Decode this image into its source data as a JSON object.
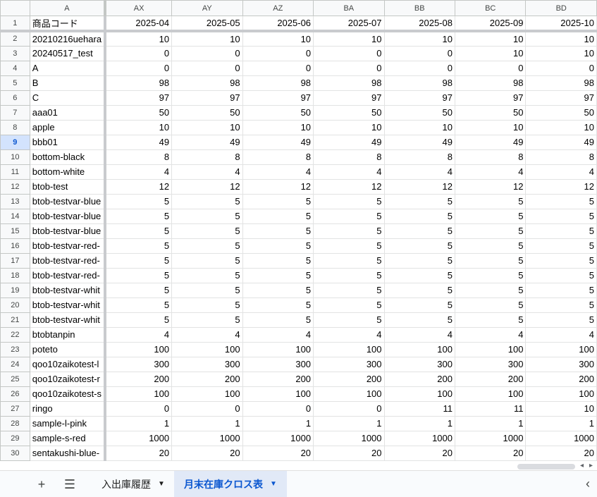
{
  "columns": [
    "A",
    "AX",
    "AY",
    "AZ",
    "BA",
    "BB",
    "BC",
    "BD"
  ],
  "header": {
    "label": "商品コード",
    "months": [
      "2025-04",
      "2025-05",
      "2025-06",
      "2025-07",
      "2025-08",
      "2025-09",
      "2025-10"
    ]
  },
  "selected_row": 9,
  "rows": [
    {
      "code": "20210216uehara",
      "values": [
        "10",
        "10",
        "10",
        "10",
        "10",
        "10",
        "10"
      ]
    },
    {
      "code": "20240517_test",
      "values": [
        "0",
        "0",
        "0",
        "0",
        "0",
        "10",
        "10"
      ]
    },
    {
      "code": "A",
      "values": [
        "0",
        "0",
        "0",
        "0",
        "0",
        "0",
        "0"
      ]
    },
    {
      "code": "B",
      "values": [
        "98",
        "98",
        "98",
        "98",
        "98",
        "98",
        "98"
      ]
    },
    {
      "code": "C",
      "values": [
        "97",
        "97",
        "97",
        "97",
        "97",
        "97",
        "97"
      ]
    },
    {
      "code": "aaa01",
      "values": [
        "50",
        "50",
        "50",
        "50",
        "50",
        "50",
        "50"
      ]
    },
    {
      "code": "apple",
      "values": [
        "10",
        "10",
        "10",
        "10",
        "10",
        "10",
        "10"
      ]
    },
    {
      "code": "bbb01",
      "values": [
        "49",
        "49",
        "49",
        "49",
        "49",
        "49",
        "49"
      ]
    },
    {
      "code": "bottom-black",
      "values": [
        "8",
        "8",
        "8",
        "8",
        "8",
        "8",
        "8"
      ]
    },
    {
      "code": "bottom-white",
      "values": [
        "4",
        "4",
        "4",
        "4",
        "4",
        "4",
        "4"
      ]
    },
    {
      "code": "btob-test",
      "values": [
        "12",
        "12",
        "12",
        "12",
        "12",
        "12",
        "12"
      ]
    },
    {
      "code": "btob-testvar-blue",
      "values": [
        "5",
        "5",
        "5",
        "5",
        "5",
        "5",
        "5"
      ]
    },
    {
      "code": "btob-testvar-blue",
      "values": [
        "5",
        "5",
        "5",
        "5",
        "5",
        "5",
        "5"
      ]
    },
    {
      "code": "btob-testvar-blue",
      "values": [
        "5",
        "5",
        "5",
        "5",
        "5",
        "5",
        "5"
      ]
    },
    {
      "code": "btob-testvar-red-",
      "values": [
        "5",
        "5",
        "5",
        "5",
        "5",
        "5",
        "5"
      ]
    },
    {
      "code": "btob-testvar-red-",
      "values": [
        "5",
        "5",
        "5",
        "5",
        "5",
        "5",
        "5"
      ]
    },
    {
      "code": "btob-testvar-red-",
      "values": [
        "5",
        "5",
        "5",
        "5",
        "5",
        "5",
        "5"
      ]
    },
    {
      "code": "btob-testvar-whit",
      "values": [
        "5",
        "5",
        "5",
        "5",
        "5",
        "5",
        "5"
      ]
    },
    {
      "code": "btob-testvar-whit",
      "values": [
        "5",
        "5",
        "5",
        "5",
        "5",
        "5",
        "5"
      ]
    },
    {
      "code": "btob-testvar-whit",
      "values": [
        "5",
        "5",
        "5",
        "5",
        "5",
        "5",
        "5"
      ]
    },
    {
      "code": "btobtanpin",
      "values": [
        "4",
        "4",
        "4",
        "4",
        "4",
        "4",
        "4"
      ]
    },
    {
      "code": "poteto",
      "values": [
        "100",
        "100",
        "100",
        "100",
        "100",
        "100",
        "100"
      ]
    },
    {
      "code": "qoo10zaikotest-l",
      "values": [
        "300",
        "300",
        "300",
        "300",
        "300",
        "300",
        "300"
      ]
    },
    {
      "code": "qoo10zaikotest-r",
      "values": [
        "200",
        "200",
        "200",
        "200",
        "200",
        "200",
        "200"
      ]
    },
    {
      "code": "qoo10zaikotest-s",
      "values": [
        "100",
        "100",
        "100",
        "100",
        "100",
        "100",
        "100"
      ]
    },
    {
      "code": "ringo",
      "values": [
        "0",
        "0",
        "0",
        "0",
        "11",
        "11",
        "10"
      ]
    },
    {
      "code": "sample-l-pink",
      "values": [
        "1",
        "1",
        "1",
        "1",
        "1",
        "1",
        "1"
      ]
    },
    {
      "code": "sample-s-red",
      "values": [
        "1000",
        "1000",
        "1000",
        "1000",
        "1000",
        "1000",
        "1000"
      ]
    },
    {
      "code": "sentakushi-blue-",
      "values": [
        "20",
        "20",
        "20",
        "20",
        "20",
        "20",
        "20"
      ]
    }
  ],
  "toolbar": {
    "add_icon": "plus-icon",
    "menu_icon": "hamburger-icon",
    "collapse_icon": "chevron-left-icon"
  },
  "tabs": [
    {
      "label": "入出庫履歴",
      "active": false
    },
    {
      "label": "月末在庫クロス表",
      "active": true
    }
  ],
  "colors": {
    "active_tab_text": "#0b57d0",
    "active_tab_bg": "#e1e9f7",
    "selected_row_header": "#d3e3fd"
  }
}
